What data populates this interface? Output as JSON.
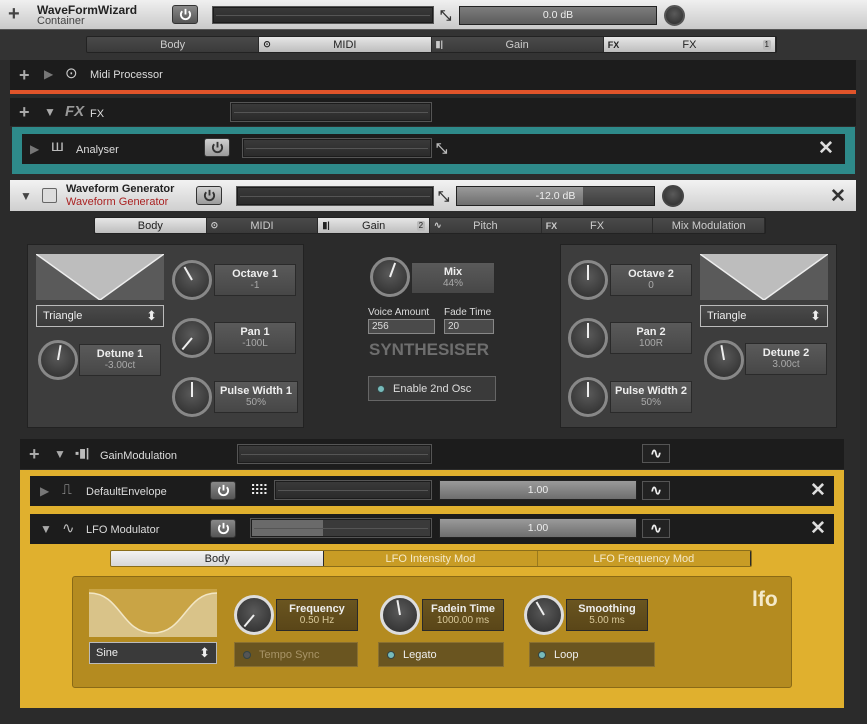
{
  "top": {
    "title": "WaveFormWizard",
    "subtitle": "Container",
    "gain": "0.0 dB"
  },
  "top_tabs": [
    {
      "label": "Body"
    },
    {
      "label": "MIDI",
      "icon": "⊙"
    },
    {
      "label": "Gain",
      "icon": "▮|"
    },
    {
      "label": "FX",
      "icon": "FX",
      "badge": "1"
    }
  ],
  "midi": {
    "label": "Midi Processor"
  },
  "fx": {
    "label": "FX",
    "icon": "FX"
  },
  "analyser": {
    "label": "Analyser"
  },
  "wg": {
    "title": "Waveform Generator",
    "subtitle": "Waveform Generator",
    "gain": "-12.0 dB"
  },
  "wg_tabs": [
    {
      "label": "Body"
    },
    {
      "label": "MIDI",
      "icon": "⊙"
    },
    {
      "label": "Gain",
      "icon": "▮|",
      "badge": "2"
    },
    {
      "label": "Pitch",
      "icon": "∿"
    },
    {
      "label": "FX",
      "icon": "FX"
    },
    {
      "label": "Mix Modulation"
    }
  ],
  "synth": {
    "wave1": "Triangle",
    "wave2": "Triangle",
    "octave1": {
      "name": "Octave 1",
      "value": "-1"
    },
    "pan1": {
      "name": "Pan 1",
      "value": "-100L"
    },
    "detune1": {
      "name": "Detune 1",
      "value": "-3.00ct"
    },
    "pw1": {
      "name": "Pulse Width 1",
      "value": "50%"
    },
    "mix": {
      "name": "Mix",
      "value": "44%"
    },
    "voice_label": "Voice Amount",
    "voice_value": "256",
    "fade_label": "Fade Time",
    "fade_value": "20",
    "title": "SYNTHESISER",
    "enable": "Enable 2nd Osc",
    "octave2": {
      "name": "Octave 2",
      "value": "0"
    },
    "pan2": {
      "name": "Pan 2",
      "value": "100R"
    },
    "detune2": {
      "name": "Detune 2",
      "value": "3.00ct"
    },
    "pw2": {
      "name": "Pulse Width 2",
      "value": "50%"
    }
  },
  "gainmod": {
    "label": "GainModulation"
  },
  "env": {
    "label": "DefaultEnvelope",
    "value": "1.00"
  },
  "lfo": {
    "label": "LFO Modulator",
    "value": "1.00"
  },
  "lfo_tabs": [
    {
      "label": "Body"
    },
    {
      "label": "LFO Intensity Mod"
    },
    {
      "label": "LFO Frequency Mod"
    }
  ],
  "lfo_body": {
    "wave": "Sine",
    "frequency": {
      "name": "Frequency",
      "value": "0.50 Hz"
    },
    "fadein": {
      "name": "Fadein Time",
      "value": "1000.00 ms"
    },
    "smoothing": {
      "name": "Smoothing",
      "value": "5.00 ms"
    },
    "tempo_sync": "Tempo Sync",
    "legato": "Legato",
    "loop": "Loop",
    "logo": "lfo"
  },
  "colors": {
    "midi_accent": "#e0542a",
    "analyser_accent": "#2e8a8a",
    "lfo_accent": "#e0b02e"
  }
}
